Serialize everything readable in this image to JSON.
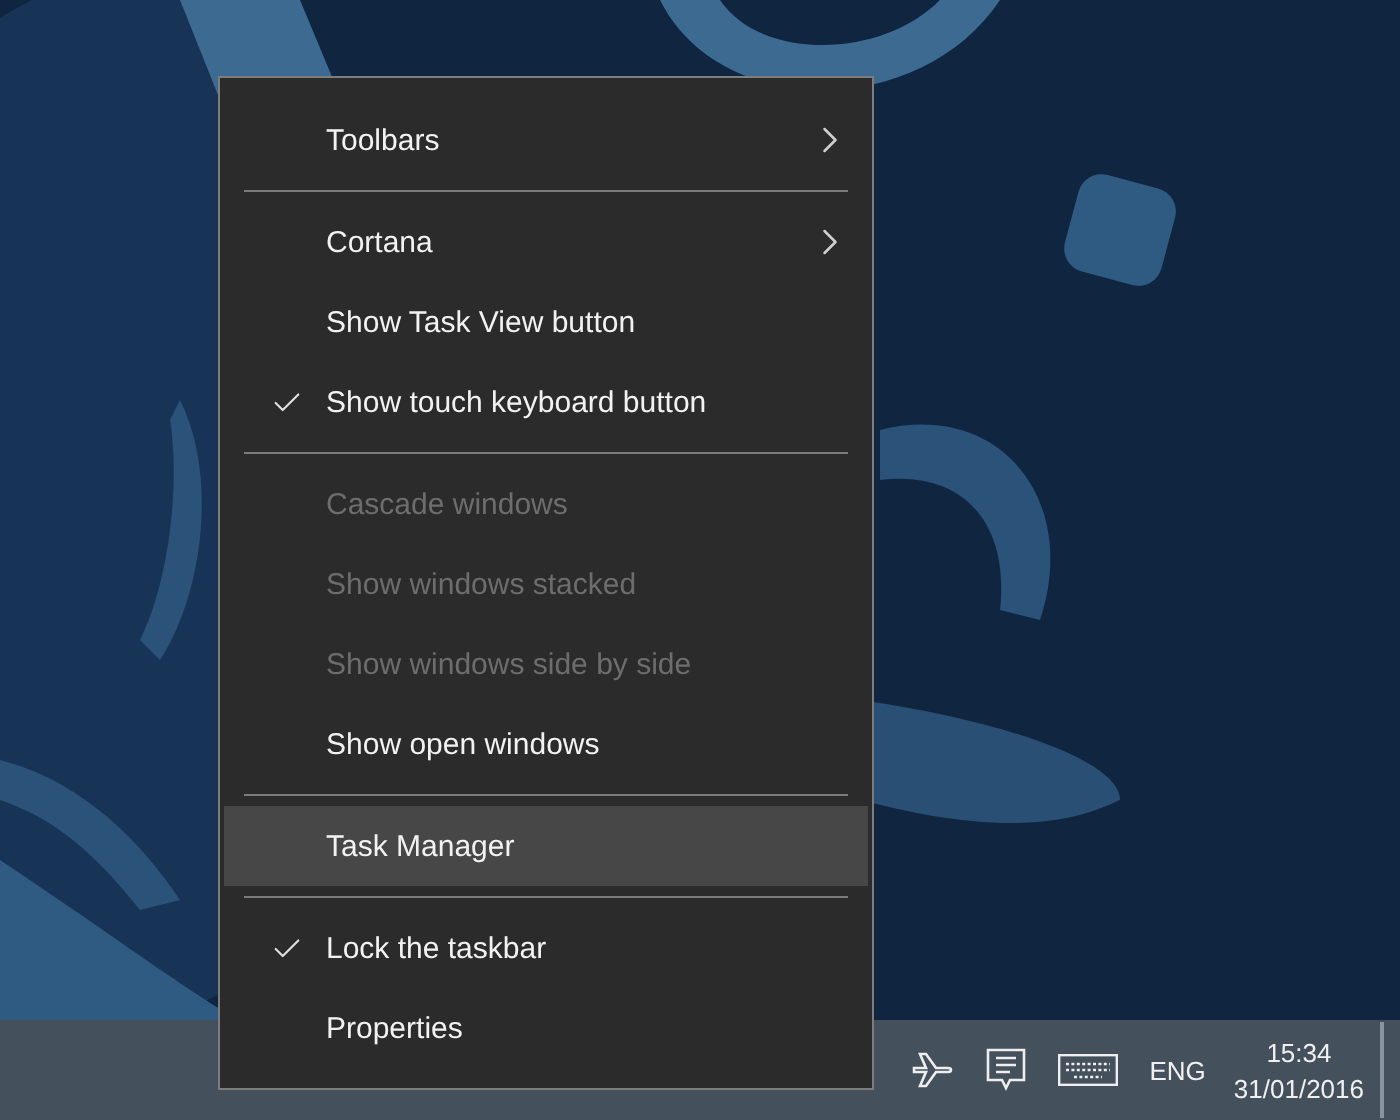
{
  "menu": {
    "sections": [
      [
        {
          "label": "Toolbars",
          "checked": false,
          "disabled": false,
          "submenu": true,
          "selected": false
        }
      ],
      [
        {
          "label": "Cortana",
          "checked": false,
          "disabled": false,
          "submenu": true,
          "selected": false
        },
        {
          "label": "Show Task View button",
          "checked": false,
          "disabled": false,
          "submenu": false,
          "selected": false
        },
        {
          "label": "Show touch keyboard button",
          "checked": true,
          "disabled": false,
          "submenu": false,
          "selected": false
        }
      ],
      [
        {
          "label": "Cascade windows",
          "checked": false,
          "disabled": true,
          "submenu": false,
          "selected": false
        },
        {
          "label": "Show windows stacked",
          "checked": false,
          "disabled": true,
          "submenu": false,
          "selected": false
        },
        {
          "label": "Show windows side by side",
          "checked": false,
          "disabled": true,
          "submenu": false,
          "selected": false
        },
        {
          "label": "Show open windows",
          "checked": false,
          "disabled": false,
          "submenu": false,
          "selected": false
        }
      ],
      [
        {
          "label": "Task Manager",
          "checked": false,
          "disabled": false,
          "submenu": false,
          "selected": true
        }
      ],
      [
        {
          "label": "Lock the taskbar",
          "checked": true,
          "disabled": false,
          "submenu": false,
          "selected": false
        },
        {
          "label": "Properties",
          "checked": false,
          "disabled": false,
          "submenu": false,
          "selected": false
        }
      ]
    ]
  },
  "taskbar": {
    "language": "ENG",
    "time": "15:34",
    "date": "31/01/2016"
  }
}
